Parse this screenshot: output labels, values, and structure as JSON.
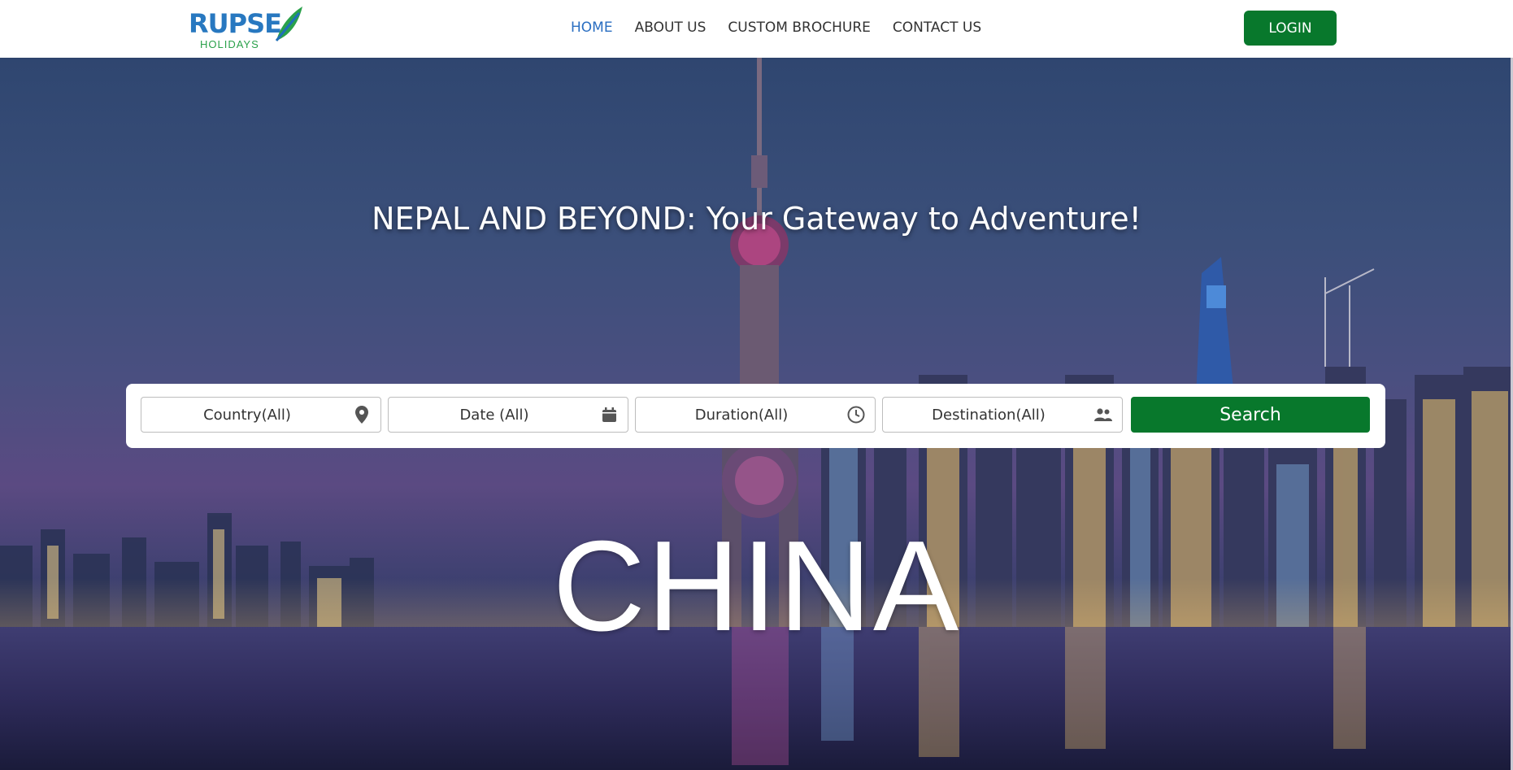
{
  "brand": {
    "name": "RUPSE",
    "sub": "HOLIDAYS"
  },
  "nav": {
    "items": [
      {
        "label": "HOME",
        "active": true
      },
      {
        "label": "ABOUT US"
      },
      {
        "label": "CUSTOM BROCHURE"
      },
      {
        "label": "CONTACT US"
      }
    ],
    "login_label": "LOGIN"
  },
  "hero": {
    "tagline": "NEPAL AND BEYOND: Your Gateway to Adventure!",
    "destination": "CHINA"
  },
  "search": {
    "fields": [
      {
        "label": "Country(All)",
        "icon": "map-pin-icon"
      },
      {
        "label": "Date (All)",
        "icon": "calendar-icon"
      },
      {
        "label": "Duration(All)",
        "icon": "clock-icon"
      },
      {
        "label": "Destination(All)",
        "icon": "people-icon"
      }
    ],
    "button_label": "Search"
  },
  "colors": {
    "accent_green": "#08782c",
    "active_link": "#2a6ec1",
    "logo_blue": "#2878c0",
    "logo_green": "#2aa14a"
  }
}
